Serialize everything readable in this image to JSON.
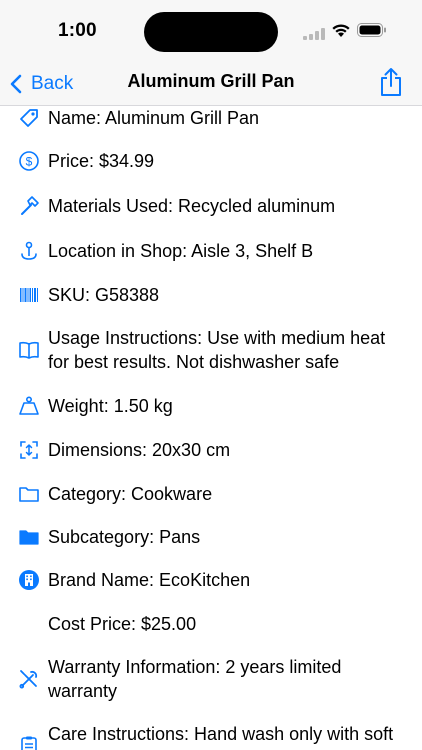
{
  "status_bar": {
    "time": "1:00"
  },
  "nav": {
    "back_label": "Back",
    "title": "Aluminum Grill Pan"
  },
  "accent_color": "#0a7aff",
  "items": [
    {
      "icon": "tag-icon",
      "text": "Name: Aluminum Grill Pan"
    },
    {
      "icon": "dollar-circle-icon",
      "text": "Price: $34.99"
    },
    {
      "icon": "hammer-icon",
      "text": "Materials Used: Recycled aluminum"
    },
    {
      "icon": "location-pin-icon",
      "text": "Location in Shop: Aisle 3, Shelf B"
    },
    {
      "icon": "barcode-icon",
      "text": "SKU: G58388"
    },
    {
      "icon": "book-icon",
      "text": "Usage Instructions: Use with medium heat for best results. Not dishwasher safe"
    },
    {
      "icon": "weight-icon",
      "text": "Weight: 1.50 kg"
    },
    {
      "icon": "dimensions-icon",
      "text": "Dimensions: 20x30 cm"
    },
    {
      "icon": "folder-icon",
      "text": "Category: Cookware"
    },
    {
      "icon": "folder-filled-icon",
      "text": "Subcategory: Pans"
    },
    {
      "icon": "building-circle-icon",
      "text": "Brand Name: EcoKitchen"
    },
    {
      "icon": "",
      "text": "Cost Price: $25.00"
    },
    {
      "icon": "wrench-screwdriver-icon",
      "text": "Warranty Information: 2 years limited warranty"
    },
    {
      "icon": "clipboard-icon",
      "text": "Care Instructions: Hand wash only with soft"
    }
  ]
}
